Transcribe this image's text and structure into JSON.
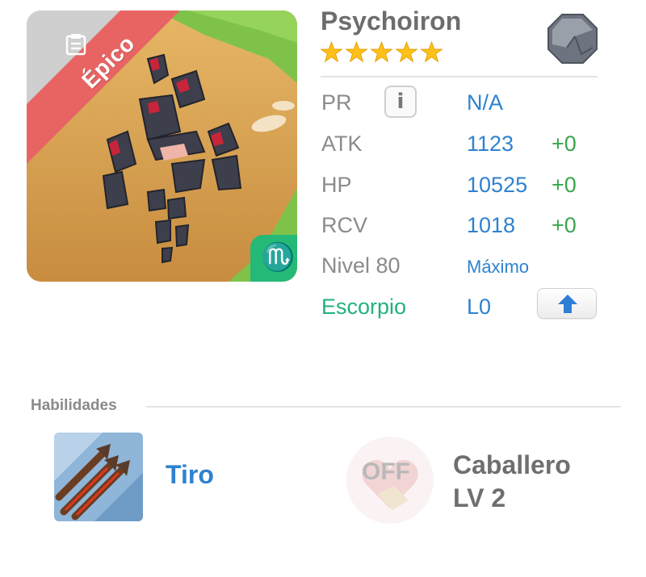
{
  "monster": {
    "name": "Psychoiron",
    "star_count": 5,
    "rarity": "Épico",
    "element_icon": "stone-element-icon",
    "zodiac_icon": "scorpio-icon",
    "colors": {
      "rarity": "#e86463",
      "zodiac": "#25b978",
      "star": "#ffc01a"
    }
  },
  "stats": {
    "pr": {
      "label": "PR",
      "value": "N/A"
    },
    "atk": {
      "label": "ATK",
      "value": "1123",
      "bonus": "+0"
    },
    "hp": {
      "label": "HP",
      "value": "10525",
      "bonus": "+0"
    },
    "rcv": {
      "label": "RCV",
      "value": "1018",
      "bonus": "+0"
    },
    "level": {
      "label": "Nivel 80",
      "value": "Máximo"
    },
    "zodiac": {
      "label": "Escorpio",
      "value": "L0"
    }
  },
  "skills": {
    "heading": "Habilidades",
    "items": [
      {
        "name": "Tiro",
        "icon": "arrows-skill-icon",
        "state": ""
      },
      {
        "name_line1": "Caballero",
        "name_line2": "LV 2",
        "icon": "heart-shield-skill-icon",
        "state": "OFF"
      }
    ]
  }
}
